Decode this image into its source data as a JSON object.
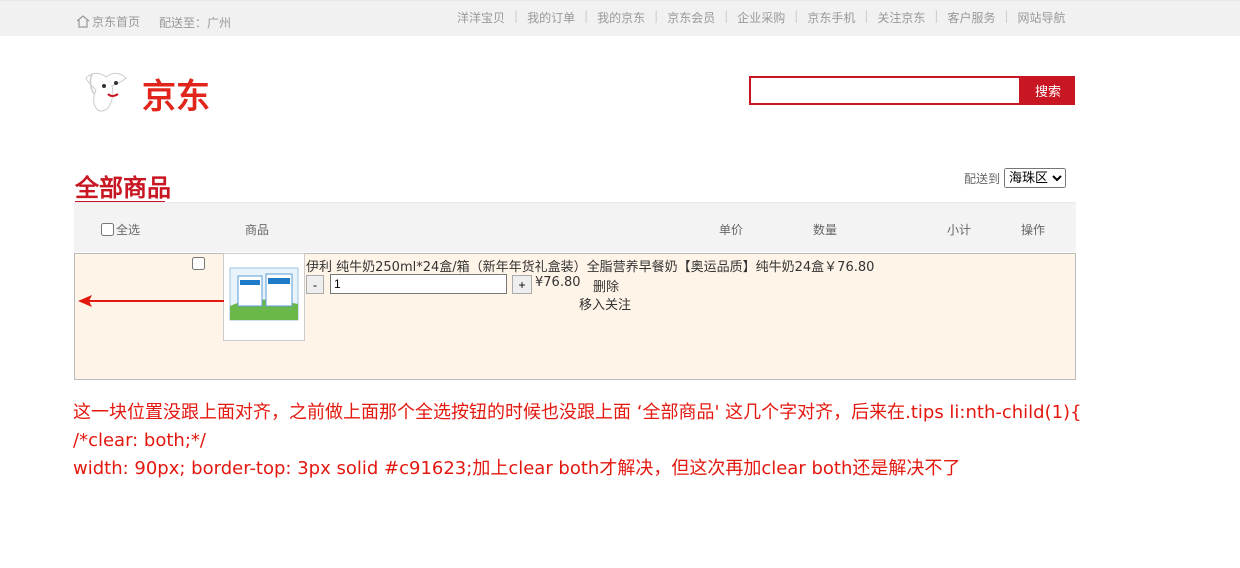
{
  "topbar": {
    "home_label": "京东首页",
    "deliver_label": "配送至：广州",
    "nav": [
      "洋洋宝贝",
      "我的订单",
      "我的京东",
      "京东会员",
      "企业采购",
      "京东手机",
      "关注京东",
      "客户服务",
      "网站导航"
    ]
  },
  "header": {
    "logo_text": "京东",
    "search_value": "",
    "search_button": "搜索"
  },
  "cart": {
    "title": "全部商品",
    "deliver_to_label": "配送到",
    "deliver_to_value": "海珠区",
    "columns": {
      "select_all": "全选",
      "product": "商品",
      "unit_price": "单价",
      "quantity": "数量",
      "subtotal": "小计",
      "actions": "操作"
    },
    "item": {
      "name": "伊利 纯牛奶250ml*24盒/箱（新年年货礼盒装）全脂营养早餐奶【奥运品质】纯牛奶24盒￥76.80",
      "minus": "-",
      "quantity": "1",
      "plus": "+",
      "subtotal": "¥76.80",
      "delete": "删除",
      "follow": "移入关注"
    }
  },
  "note": {
    "line1": "这一块位置没跟上面对齐，之前做上面那个全选按钮的时候也没跟上面 ‘全部商品' 这几个字对齐，后来在.tips li:nth-child(1){",
    "line2": "/*clear: both;*/",
    "line3": "width: 90px; border-top: 3px solid #c91623;加上clear both才解决，但这次再加clear both还是解决不了"
  },
  "colors": {
    "brand": "#c91623",
    "annotation": "#e3180f",
    "row_bg": "#fff4e8"
  }
}
